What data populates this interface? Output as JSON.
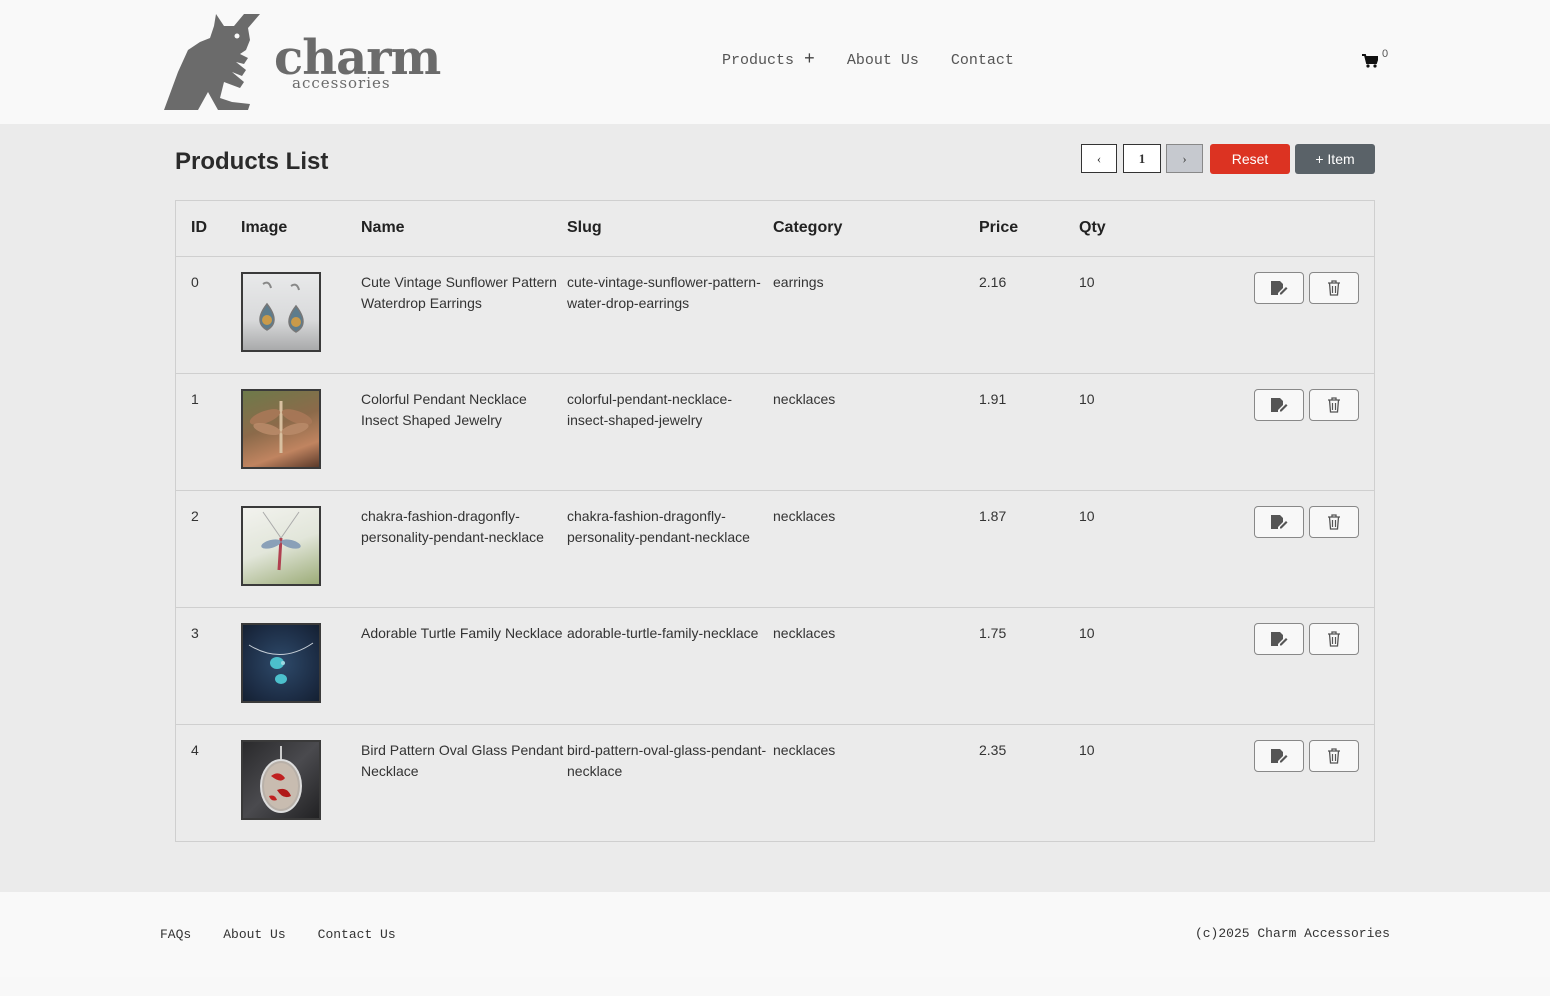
{
  "brand": {
    "name": "charm",
    "tagline": "accessories"
  },
  "nav": {
    "items": [
      {
        "label": "Products",
        "has_plus": true
      },
      {
        "label": "About Us"
      },
      {
        "label": "Contact"
      }
    ],
    "cart_count": "0"
  },
  "main": {
    "title": "Products List",
    "pager": {
      "prev": "‹",
      "page": "1",
      "next": "›"
    },
    "reset_label": "Reset",
    "add_label": "+ Item"
  },
  "table": {
    "headers": [
      "ID",
      "Image",
      "Name",
      "Slug",
      "Category",
      "Price",
      "Qty"
    ],
    "rows": [
      {
        "id": "0",
        "name": "Cute Vintage Sunflower Pattern Waterdrop Earrings",
        "slug": "cute-vintage-sunflower-pattern-water-drop-earrings",
        "category": "earrings",
        "price": "2.16",
        "qty": "10",
        "image": "earrings-thumbnail"
      },
      {
        "id": "1",
        "name": "Colorful Pendant Necklace Insect Shaped Jewelry",
        "slug": "colorful-pendant-necklace-insect-shaped-jewelry",
        "category": "necklaces",
        "price": "1.91",
        "qty": "10",
        "image": "dragonfly-pendant-thumbnail"
      },
      {
        "id": "2",
        "name": "chakra-fashion-dragonfly-personality-pendant-necklace",
        "slug": "chakra-fashion-dragonfly-personality-pendant-necklace",
        "category": "necklaces",
        "price": "1.87",
        "qty": "10",
        "image": "chakra-dragonfly-thumbnail"
      },
      {
        "id": "3",
        "name": "Adorable Turtle Family Necklace",
        "slug": "adorable-turtle-family-necklace",
        "category": "necklaces",
        "price": "1.75",
        "qty": "10",
        "image": "turtle-necklace-thumbnail"
      },
      {
        "id": "4",
        "name": "Bird Pattern Oval Glass Pendant Necklace",
        "slug": "bird-pattern-oval-glass-pendant-necklace",
        "category": "necklaces",
        "price": "2.35",
        "qty": "10",
        "image": "bird-pendant-thumbnail"
      }
    ]
  },
  "footer": {
    "links": [
      "FAQs",
      "About Us",
      "Contact Us"
    ],
    "copyright": "(c)2025 Charm Accessories"
  },
  "icons": {
    "cart": "shopping-cart-icon",
    "edit": "edit-icon",
    "delete": "trash-icon",
    "plus": "plus-icon"
  },
  "colors": {
    "reset_button": "#dc3322",
    "add_button": "#5a6268",
    "logo": "#6b6b6b"
  }
}
